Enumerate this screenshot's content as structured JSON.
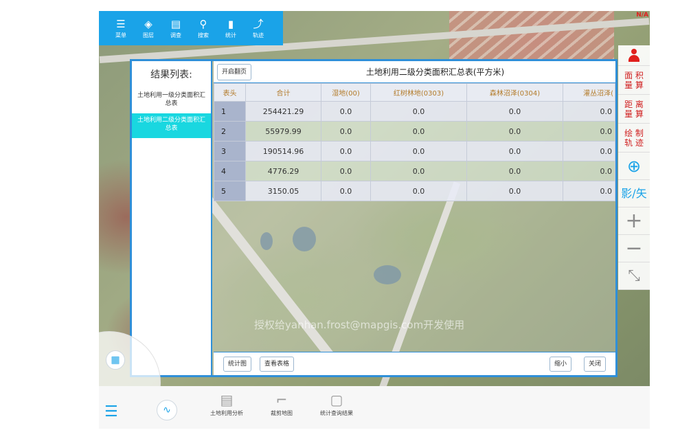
{
  "toolbar": {
    "items": [
      {
        "label": "菜单",
        "icon": "menu-icon",
        "glyph": "☰"
      },
      {
        "label": "图层",
        "icon": "layers-icon",
        "glyph": "◈"
      },
      {
        "label": "调查",
        "icon": "survey-icon",
        "glyph": "▤"
      },
      {
        "label": "搜索",
        "icon": "search-icon",
        "glyph": "⚲"
      },
      {
        "label": "统计",
        "icon": "stats-icon",
        "glyph": "▮"
      },
      {
        "label": "轨迹",
        "icon": "track-icon",
        "glyph": "⤴"
      }
    ]
  },
  "status": {
    "na": "N/A"
  },
  "right_tools": {
    "area": "面 积\n量 算",
    "distance": "距 离\n量 算",
    "track": "绘 制\n轨 迹",
    "locate_glyph": "⊕",
    "vector_label": "影/矢",
    "zoom_in": "+",
    "zoom_out": "−",
    "shrink_glyph": "⤡"
  },
  "dialog": {
    "list_title": "结果列表:",
    "list_items": [
      {
        "label": "土地利用一级分类面积汇总表",
        "selected": false
      },
      {
        "label": "土地利用二级分类面积汇总表",
        "selected": true
      }
    ],
    "page_button": "开启翻页",
    "table_title": "土地利用二级分类面积汇总表(平方米)",
    "columns": [
      "表头",
      "合计",
      "湿地(00)",
      "红树林地(0303)",
      "森林沼泽(0304)",
      "灌丛沼泽("
    ],
    "rows": [
      [
        "1",
        "254421.29",
        "0.0",
        "0.0",
        "0.0",
        "0.0"
      ],
      [
        "2",
        "55979.99",
        "0.0",
        "0.0",
        "0.0",
        "0.0"
      ],
      [
        "3",
        "190514.96",
        "0.0",
        "0.0",
        "0.0",
        "0.0"
      ],
      [
        "4",
        "4776.29",
        "0.0",
        "0.0",
        "0.0",
        "0.0"
      ],
      [
        "5",
        "3150.05",
        "0.0",
        "0.0",
        "0.0",
        "0.0"
      ]
    ],
    "chart_button": "统计图",
    "table_button": "查看表格",
    "shrink_button": "缩小",
    "close_button": "关闭"
  },
  "watermark": "授权给yanhan.frost@mapgis.com开发使用",
  "bottom_panel": {
    "items": [
      {
        "label": "土地利用分析",
        "glyph": "▤"
      },
      {
        "label": "裁剪地图",
        "glyph": "⌐"
      },
      {
        "label": "统计查询结果",
        "glyph": "▢"
      }
    ]
  }
}
